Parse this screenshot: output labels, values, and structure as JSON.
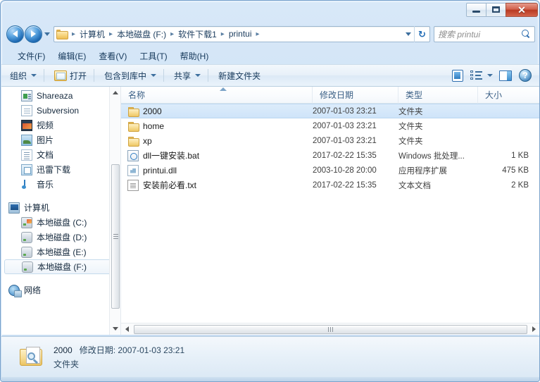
{
  "window": {
    "minimize_label": "–",
    "maximize_label": "□",
    "close_label": "✕"
  },
  "address_bar": {
    "back_tooltip": "后退",
    "forward_tooltip": "前进",
    "crumbs": [
      "计算机",
      "本地磁盘 (F:)",
      "软件下载1",
      "printui"
    ],
    "separator": "▸",
    "refresh_glyph": "↻"
  },
  "search": {
    "placeholder": "搜索 printui"
  },
  "menubar": {
    "items": [
      "文件(F)",
      "编辑(E)",
      "查看(V)",
      "工具(T)",
      "帮助(H)"
    ]
  },
  "toolbar": {
    "organize": "组织",
    "open": "打开",
    "include_in_library": "包含到库中",
    "share": "共享",
    "new_folder": "新建文件夹",
    "help_glyph": "?"
  },
  "navpane": {
    "items": [
      {
        "label": "Shareaza",
        "icon": "shareaza-icon",
        "level": 1,
        "selected": false
      },
      {
        "label": "Subversion",
        "icon": "subversion-icon",
        "level": 1,
        "selected": false
      },
      {
        "label": "视频",
        "icon": "video-icon",
        "level": 1,
        "selected": false
      },
      {
        "label": "图片",
        "icon": "pictures-icon",
        "level": 1,
        "selected": false
      },
      {
        "label": "文档",
        "icon": "documents-icon",
        "level": 1,
        "selected": false
      },
      {
        "label": "迅雷下载",
        "icon": "xunlei-icon",
        "level": 1,
        "selected": false
      },
      {
        "label": "音乐",
        "icon": "music-icon",
        "level": 1,
        "selected": false
      },
      {
        "label": "__SPACER__",
        "icon": "",
        "level": 0,
        "selected": false
      },
      {
        "label": "计算机",
        "icon": "computer-icon",
        "level": 0,
        "selected": false
      },
      {
        "label": "本地磁盘 (C:)",
        "icon": "drive-system-icon",
        "level": 1,
        "selected": false
      },
      {
        "label": "本地磁盘 (D:)",
        "icon": "drive-icon",
        "level": 1,
        "selected": false
      },
      {
        "label": "本地磁盘 (E:)",
        "icon": "drive-icon",
        "level": 1,
        "selected": false
      },
      {
        "label": "本地磁盘 (F:)",
        "icon": "drive-icon",
        "level": 1,
        "selected": true
      },
      {
        "label": "__SPACER__",
        "icon": "",
        "level": 0,
        "selected": false
      },
      {
        "label": "网络",
        "icon": "network-icon",
        "level": 0,
        "selected": false
      }
    ]
  },
  "filelist": {
    "columns": [
      {
        "key": "name",
        "label": "名称",
        "sorted": true
      },
      {
        "key": "date",
        "label": "修改日期",
        "sorted": false
      },
      {
        "key": "type",
        "label": "类型",
        "sorted": false
      },
      {
        "key": "size",
        "label": "大小",
        "sorted": false
      }
    ],
    "rows": [
      {
        "name": "2000",
        "date": "2007-01-03 23:21",
        "type": "文件夹",
        "size": "",
        "icon": "folder-icon",
        "selected": true
      },
      {
        "name": "home",
        "date": "2007-01-03 23:21",
        "type": "文件夹",
        "size": "",
        "icon": "folder-icon",
        "selected": false
      },
      {
        "name": "xp",
        "date": "2007-01-03 23:21",
        "type": "文件夹",
        "size": "",
        "icon": "folder-icon",
        "selected": false
      },
      {
        "name": "dll一键安装.bat",
        "date": "2017-02-22 15:35",
        "type": "Windows 批处理...",
        "size": "1 KB",
        "icon": "bat-file-icon",
        "selected": false
      },
      {
        "name": "printui.dll",
        "date": "2003-10-28 20:00",
        "type": "应用程序扩展",
        "size": "475 KB",
        "icon": "dll-file-icon",
        "selected": false
      },
      {
        "name": "安装前必看.txt",
        "date": "2017-02-22 15:35",
        "type": "文本文档",
        "size": "2 KB",
        "icon": "txt-file-icon",
        "selected": false
      }
    ]
  },
  "statuspane": {
    "name": "2000",
    "meta": "修改日期: 2007-01-03 23:21",
    "type": "文件夹"
  },
  "colors": {
    "frame": "#c6dcf2",
    "selection": "#cfe4f9",
    "accent": "#2f6fb0",
    "close_button": "#b83a22"
  }
}
